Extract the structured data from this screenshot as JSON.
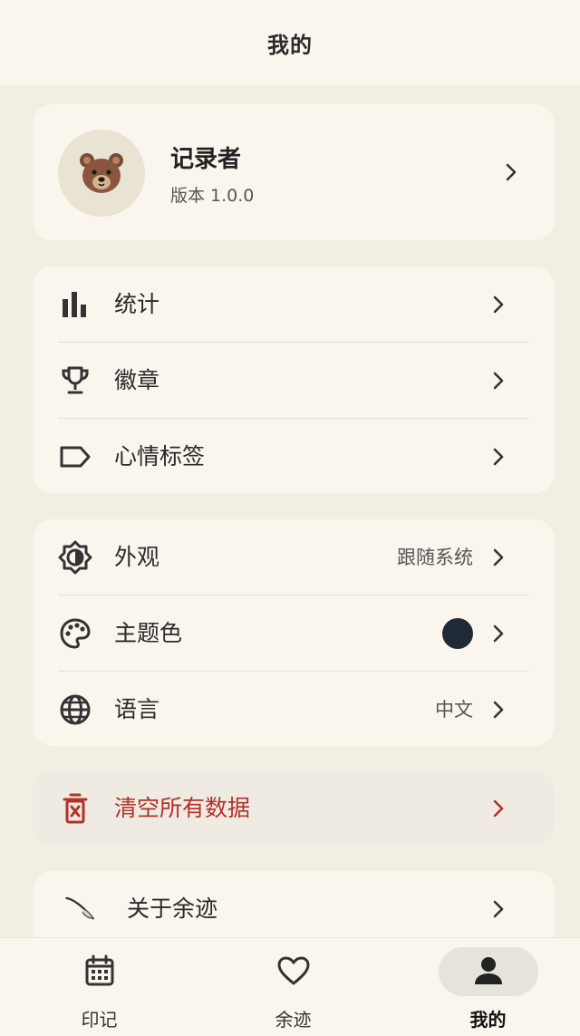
{
  "header": {
    "title": "我的"
  },
  "profile": {
    "name": "记录者",
    "version": "版本 1.0.0",
    "avatar_icon": "bear-face-icon"
  },
  "group1": [
    {
      "label": "统计",
      "icon": "bar-chart-icon"
    },
    {
      "label": "徽章",
      "icon": "trophy-icon"
    },
    {
      "label": "心情标签",
      "icon": "label-tag-icon"
    }
  ],
  "group2": [
    {
      "label": "外观",
      "icon": "brightness-icon",
      "value": "跟随系统"
    },
    {
      "label": "主题色",
      "icon": "palette-icon",
      "value_color": "#1f2937"
    },
    {
      "label": "语言",
      "icon": "globe-icon",
      "value": "中文"
    }
  ],
  "danger": {
    "label": "清空所有数据",
    "icon": "delete-icon",
    "color": "#b0332a"
  },
  "about": {
    "label": "关于余迹",
    "icon": "feather-icon"
  },
  "bottom_nav": [
    {
      "label": "印记",
      "icon": "calendar-icon",
      "active": false
    },
    {
      "label": "余迹",
      "icon": "heart-icon",
      "active": false
    },
    {
      "label": "我的",
      "icon": "person-icon",
      "active": true
    }
  ]
}
